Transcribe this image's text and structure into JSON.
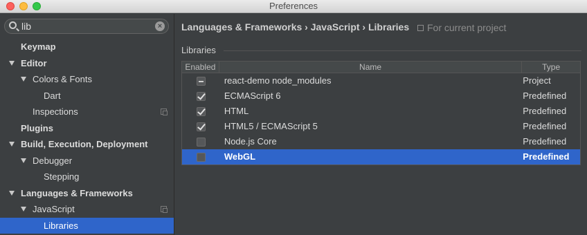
{
  "window": {
    "title": "Preferences"
  },
  "sidebar": {
    "search": {
      "value": "lib"
    },
    "items": [
      {
        "label": "Keymap",
        "bold": true,
        "level": 0,
        "arrow": false
      },
      {
        "label": "Editor",
        "bold": true,
        "level": 0,
        "arrow": true
      },
      {
        "label": "Colors & Fonts",
        "bold": false,
        "level": 1,
        "arrow": true
      },
      {
        "label": "Dart",
        "bold": false,
        "level": 2,
        "arrow": false
      },
      {
        "label": "Inspections",
        "bold": false,
        "level": 1,
        "arrow": false,
        "project_icon": true
      },
      {
        "label": "Plugins",
        "bold": true,
        "level": 0,
        "arrow": false
      },
      {
        "label": "Build, Execution, Deployment",
        "bold": true,
        "level": 0,
        "arrow": true
      },
      {
        "label": "Debugger",
        "bold": false,
        "level": 1,
        "arrow": true
      },
      {
        "label": "Stepping",
        "bold": false,
        "level": 2,
        "arrow": false
      },
      {
        "label": "Languages & Frameworks",
        "bold": true,
        "level": 0,
        "arrow": true
      },
      {
        "label": "JavaScript",
        "bold": false,
        "level": 1,
        "arrow": true,
        "project_icon": true
      },
      {
        "label": "Libraries",
        "bold": false,
        "level": 2,
        "arrow": false,
        "selected": true
      }
    ]
  },
  "main": {
    "breadcrumb": "Languages & Frameworks › JavaScript › Libraries",
    "scope": "For current project",
    "section_title": "Libraries",
    "table": {
      "columns": [
        "Enabled",
        "Name",
        "Type"
      ],
      "rows": [
        {
          "enabled": "partial",
          "name": "react-demo node_modules",
          "type": "Project"
        },
        {
          "enabled": "checked",
          "name": "ECMAScript 6",
          "type": "Predefined"
        },
        {
          "enabled": "checked",
          "name": "HTML",
          "type": "Predefined"
        },
        {
          "enabled": "checked",
          "name": "HTML5 / ECMAScript 5",
          "type": "Predefined"
        },
        {
          "enabled": "unchecked",
          "name": "Node.js Core",
          "type": "Predefined"
        },
        {
          "enabled": "unchecked",
          "name": "WebGL",
          "type": "Predefined",
          "selected": true
        }
      ]
    }
  },
  "colors": {
    "selection": "#2f65ca",
    "background": "#3c3f41"
  }
}
